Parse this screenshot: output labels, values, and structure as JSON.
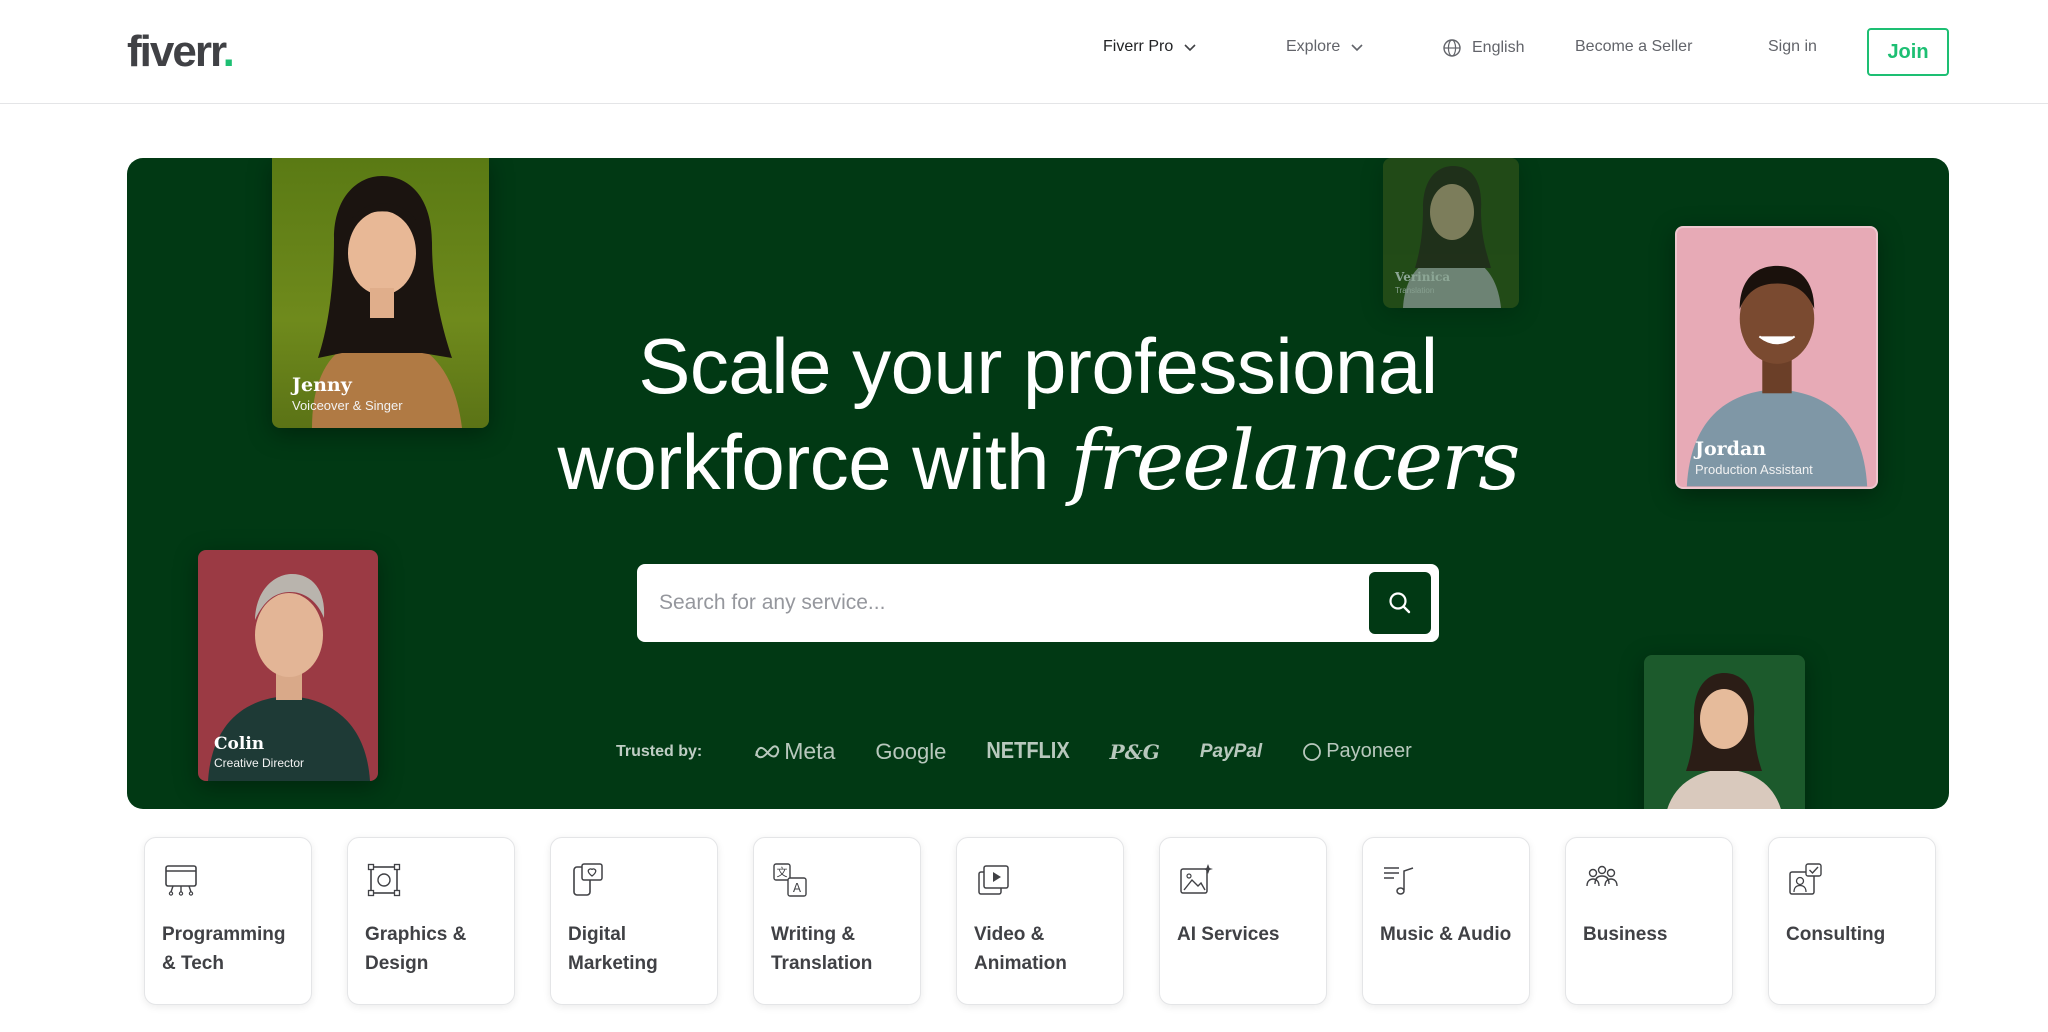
{
  "header": {
    "logo": "fiverr",
    "logo_dot": ".",
    "nav": {
      "fiverr_pro": "Fiverr Pro",
      "explore": "Explore",
      "language": "English",
      "become_seller": "Become a Seller",
      "sign_in": "Sign in",
      "join": "Join"
    }
  },
  "hero": {
    "headline_line1": "Scale your professional",
    "headline_line2_plain": "workforce with ",
    "headline_line2_emph": "freelancers",
    "search": {
      "placeholder": "Search for any service..."
    },
    "trusted_by": {
      "label": "Trusted by:",
      "brands": [
        "Meta",
        "Google",
        "NETFLIX",
        "P&G",
        "PayPal",
        "Payoneer"
      ]
    },
    "freelancers": [
      {
        "name": "Jenny",
        "role": "Voiceover & Singer"
      },
      {
        "name": "Colin",
        "role": "Creative Director"
      },
      {
        "name": "Verinica",
        "role": "Translation"
      },
      {
        "name": "Jordan",
        "role": "Production Assistant"
      }
    ]
  },
  "categories": [
    {
      "label": "Programming & Tech",
      "icon": "monitor-icon"
    },
    {
      "label": "Graphics & Design",
      "icon": "design-frame-icon"
    },
    {
      "label": "Digital Marketing",
      "icon": "phone-heart-icon"
    },
    {
      "label": "Writing & Translation",
      "icon": "translate-icon"
    },
    {
      "label": "Video & Animation",
      "icon": "video-play-icon"
    },
    {
      "label": "AI Services",
      "icon": "ai-image-icon"
    },
    {
      "label": "Music & Audio",
      "icon": "music-note-icon"
    },
    {
      "label": "Business",
      "icon": "people-group-icon"
    },
    {
      "label": "Consulting",
      "icon": "consulting-icon"
    }
  ],
  "colors": {
    "brand_green": "#1dbf73",
    "hero_bg": "#013914",
    "text_dark": "#222325",
    "text_muted": "#62646a"
  }
}
